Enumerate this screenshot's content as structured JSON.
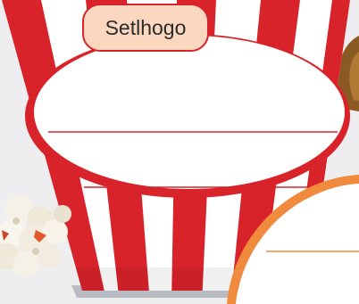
{
  "title": "Setlhogo",
  "colors": {
    "stripe_red": "#d8232a",
    "stripe_white": "#ffffff",
    "bucket_shadow": "#b8bcc2",
    "title_fill": "#fbd7c0",
    "writing_line": "#d8232a",
    "bubble_border": "#f08a3c",
    "background": "#eeeef0",
    "popcorn_cream": "#f5f1e6",
    "kernel_orange": "#e2572b",
    "brown_shape": "#8a5a24"
  },
  "main_bubble": {
    "line_count": 2
  },
  "side_bubble": {
    "line_count": 1
  }
}
